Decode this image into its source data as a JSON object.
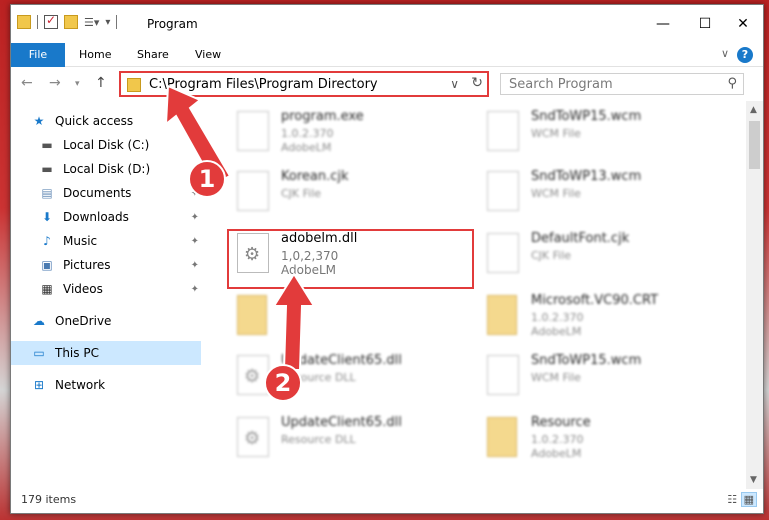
{
  "window": {
    "title": "Program"
  },
  "ribbon": {
    "file": "File",
    "home": "Home",
    "share": "Share",
    "view": "View",
    "help": "?"
  },
  "address": {
    "path": "C:\\Program Files\\Program Directory"
  },
  "search": {
    "placeholder": "Search Program"
  },
  "sidebar": {
    "items": [
      {
        "label": "Quick access",
        "icon": "star-icon"
      },
      {
        "label": "Local Disk (C:)",
        "icon": "drive-icon"
      },
      {
        "label": "Local Disk (D:)",
        "icon": "drive-icon"
      },
      {
        "label": "Documents",
        "icon": "documents-icon"
      },
      {
        "label": "Downloads",
        "icon": "download-icon"
      },
      {
        "label": "Music",
        "icon": "music-icon"
      },
      {
        "label": "Pictures",
        "icon": "pictures-icon"
      },
      {
        "label": "Videos",
        "icon": "videos-icon"
      },
      {
        "label": "OneDrive",
        "icon": "cloud-icon"
      },
      {
        "label": "This PC",
        "icon": "computer-icon"
      },
      {
        "label": "Network",
        "icon": "network-icon"
      }
    ]
  },
  "files": [
    {
      "name": "program.exe",
      "line2": "1.0.2.370",
      "line3": "AdobeLM"
    },
    {
      "name": "SndToWP15.wcm",
      "line2": "WCM File",
      "line3": ""
    },
    {
      "name": "Korean.cjk",
      "line2": "CJK File",
      "line3": ""
    },
    {
      "name": "SndToWP13.wcm",
      "line2": "WCM File",
      "line3": ""
    },
    {
      "name": "adobelm.dll",
      "line2": "1,0,2,370",
      "line3": "AdobeLM"
    },
    {
      "name": "DefaultFont.cjk",
      "line2": "CJK File",
      "line3": ""
    },
    {
      "name": "",
      "line2": "",
      "line3": ""
    },
    {
      "name": "Microsoft.VC90.CRT",
      "line2": "1.0.2.370",
      "line3": "AdobeLM"
    },
    {
      "name": "UpdateClient65.dll",
      "line2": "Resource DLL",
      "line3": ""
    },
    {
      "name": "SndToWP15.wcm",
      "line2": "WCM File",
      "line3": ""
    },
    {
      "name": "UpdateClient65.dll",
      "line2": "Resource DLL",
      "line3": ""
    },
    {
      "name": "Resource",
      "line2": "1.0.2.370",
      "line3": "AdobeLM"
    }
  ],
  "status": {
    "count": "179 items"
  },
  "callouts": {
    "one": "1",
    "two": "2"
  },
  "colors": {
    "accent": "#1979ca",
    "highlight": "#e23b3b"
  }
}
